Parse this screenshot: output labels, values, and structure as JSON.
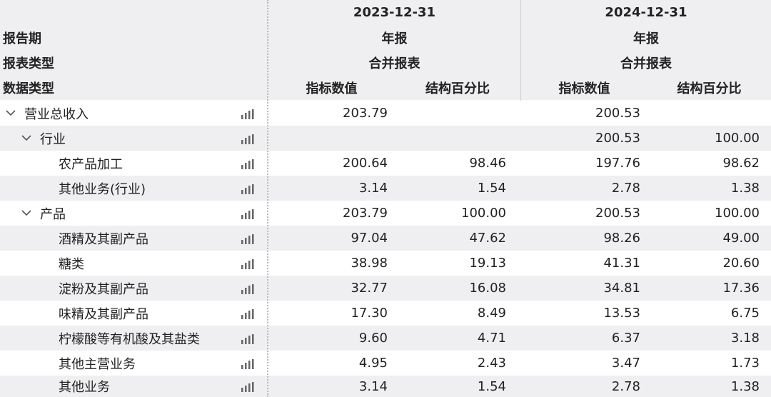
{
  "header": {
    "period_label": "报告期",
    "report_type_label": "报表类型",
    "data_type_label": "数据类型",
    "period_1": {
      "date": "2023-12-31",
      "period": "年报",
      "report_type": "合并报表",
      "value_label": "指标数值",
      "pct_label": "结构百分比"
    },
    "period_2": {
      "date": "2024-12-31",
      "period": "年报",
      "report_type": "合并报表",
      "value_label": "指标数值",
      "pct_label": "结构百分比"
    }
  },
  "icons": {
    "expand": "chevron-down-icon",
    "chart": "bar-chart-icon"
  },
  "rows": [
    {
      "label": "营业总收入",
      "v1": "203.79",
      "p1": "",
      "v2": "200.53",
      "p2": ""
    },
    {
      "label": "行业",
      "v1": "",
      "p1": "",
      "v2": "200.53",
      "p2": "100.00"
    },
    {
      "label": "农产品加工",
      "v1": "200.64",
      "p1": "98.46",
      "v2": "197.76",
      "p2": "98.62"
    },
    {
      "label": "其他业务(行业)",
      "v1": "3.14",
      "p1": "1.54",
      "v2": "2.78",
      "p2": "1.38"
    },
    {
      "label": "产品",
      "v1": "203.79",
      "p1": "100.00",
      "v2": "200.53",
      "p2": "100.00"
    },
    {
      "label": "酒精及其副产品",
      "v1": "97.04",
      "p1": "47.62",
      "v2": "98.26",
      "p2": "49.00"
    },
    {
      "label": "糖类",
      "v1": "38.98",
      "p1": "19.13",
      "v2": "41.31",
      "p2": "20.60"
    },
    {
      "label": "淀粉及其副产品",
      "v1": "32.77",
      "p1": "16.08",
      "v2": "34.81",
      "p2": "17.36"
    },
    {
      "label": "味精及其副产品",
      "v1": "17.30",
      "p1": "8.49",
      "v2": "13.53",
      "p2": "6.75"
    },
    {
      "label": "柠檬酸等有机酸及其盐类",
      "v1": "9.60",
      "p1": "4.71",
      "v2": "6.37",
      "p2": "3.18"
    },
    {
      "label": "其他主营业务",
      "v1": "4.95",
      "p1": "2.43",
      "v2": "3.47",
      "p2": "1.73"
    },
    {
      "label": "其他业务",
      "v1": "3.14",
      "p1": "1.54",
      "v2": "2.78",
      "p2": "1.38"
    }
  ]
}
